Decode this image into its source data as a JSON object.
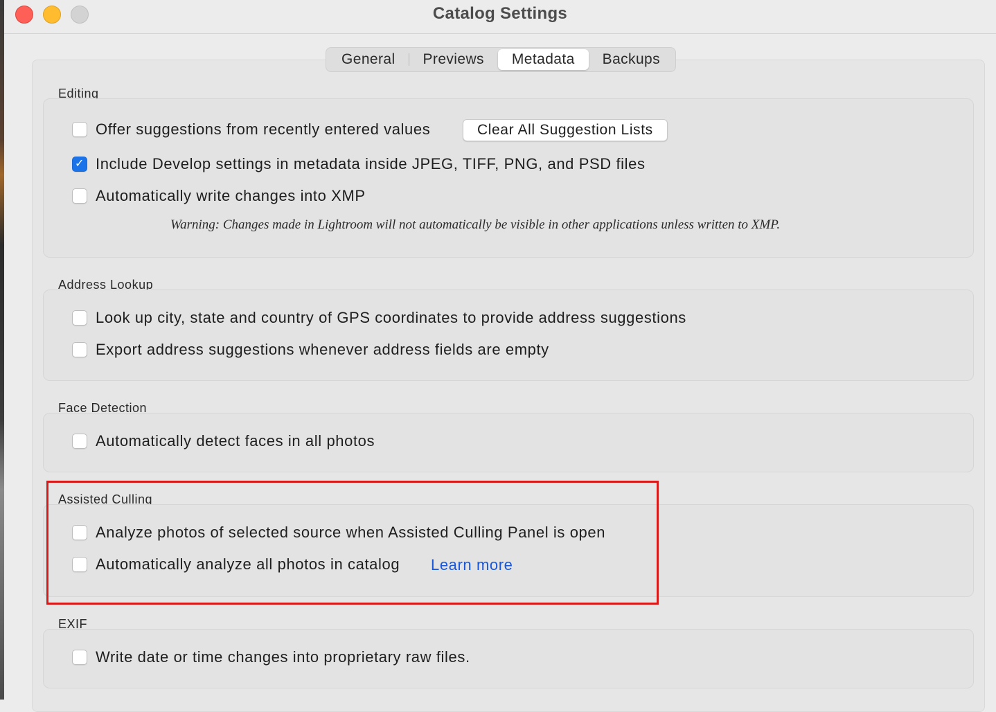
{
  "window": {
    "title": "Catalog Settings"
  },
  "tabs": [
    {
      "label": "General",
      "active": false
    },
    {
      "label": "Previews",
      "active": false
    },
    {
      "label": "Metadata",
      "active": true
    },
    {
      "label": "Backups",
      "active": false
    }
  ],
  "editing": {
    "title": "Editing",
    "offer_suggestions": {
      "label": "Offer suggestions from recently entered values",
      "checked": false
    },
    "clear_button": "Clear All Suggestion Lists",
    "include_develop": {
      "label": "Include Develop settings in metadata inside JPEG, TIFF, PNG, and PSD files",
      "checked": true
    },
    "auto_write_xmp": {
      "label": "Automatically write changes into XMP",
      "checked": false
    },
    "warning": "Warning: Changes made in Lightroom will not automatically be visible in other applications unless written to XMP."
  },
  "address_lookup": {
    "title": "Address Lookup",
    "gps_lookup": {
      "label": "Look up city, state and country of GPS coordinates to provide address suggestions",
      "checked": false
    },
    "export_suggestions": {
      "label": "Export address suggestions whenever address fields are empty",
      "checked": false
    }
  },
  "face_detection": {
    "title": "Face Detection",
    "detect_faces": {
      "label": "Automatically detect faces in all photos",
      "checked": false
    }
  },
  "assisted_culling": {
    "title": "Assisted Culling",
    "analyze_selected": {
      "label": "Analyze photos of selected source when Assisted Culling Panel is open",
      "checked": false
    },
    "analyze_all": {
      "label": "Automatically analyze all photos in catalog",
      "checked": false
    },
    "learn_more": "Learn more"
  },
  "exif": {
    "title": "EXIF",
    "write_date": {
      "label": "Write date or time changes into proprietary raw files.",
      "checked": false
    }
  },
  "colors": {
    "accent": "#1a73e8",
    "link": "#1a57d8",
    "highlight": "#d61a1a"
  },
  "icons": {
    "checkmark": "checkmark-icon"
  }
}
